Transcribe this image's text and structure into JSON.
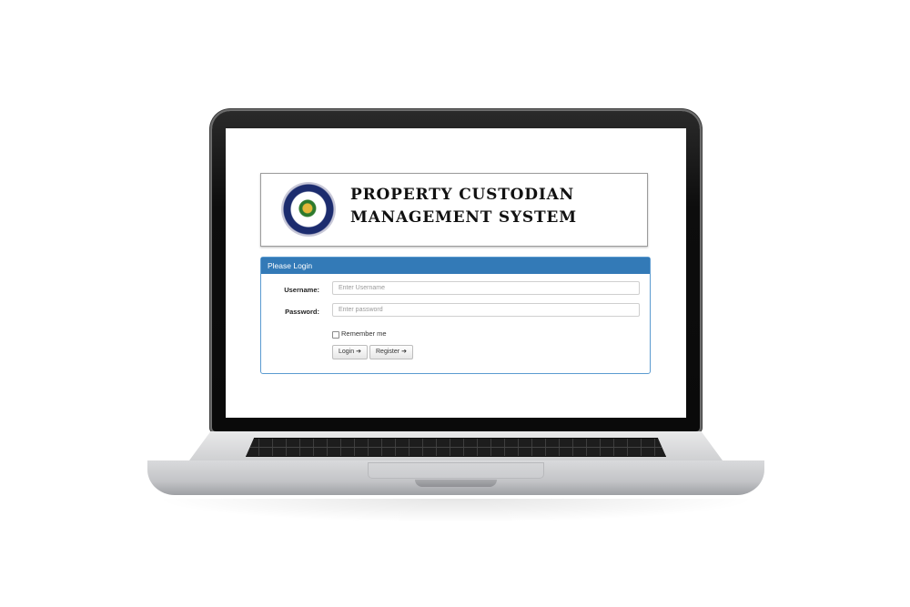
{
  "header": {
    "title_line1": "PROPERTY CUSTODIAN",
    "title_line2": "MANAGEMENT SYSTEM",
    "logo": "school-seal"
  },
  "login_panel": {
    "heading": "Please Login",
    "username_label": "Username:",
    "username_placeholder": "Enter Username",
    "password_label": "Password:",
    "password_placeholder": "Enter password",
    "remember_label": "Remember me",
    "login_button": "Login",
    "register_button": "Register",
    "button_icon": "sign-in-icon"
  },
  "colors": {
    "panel_heading": "#337ab7",
    "panel_border": "#5b9bd0"
  }
}
